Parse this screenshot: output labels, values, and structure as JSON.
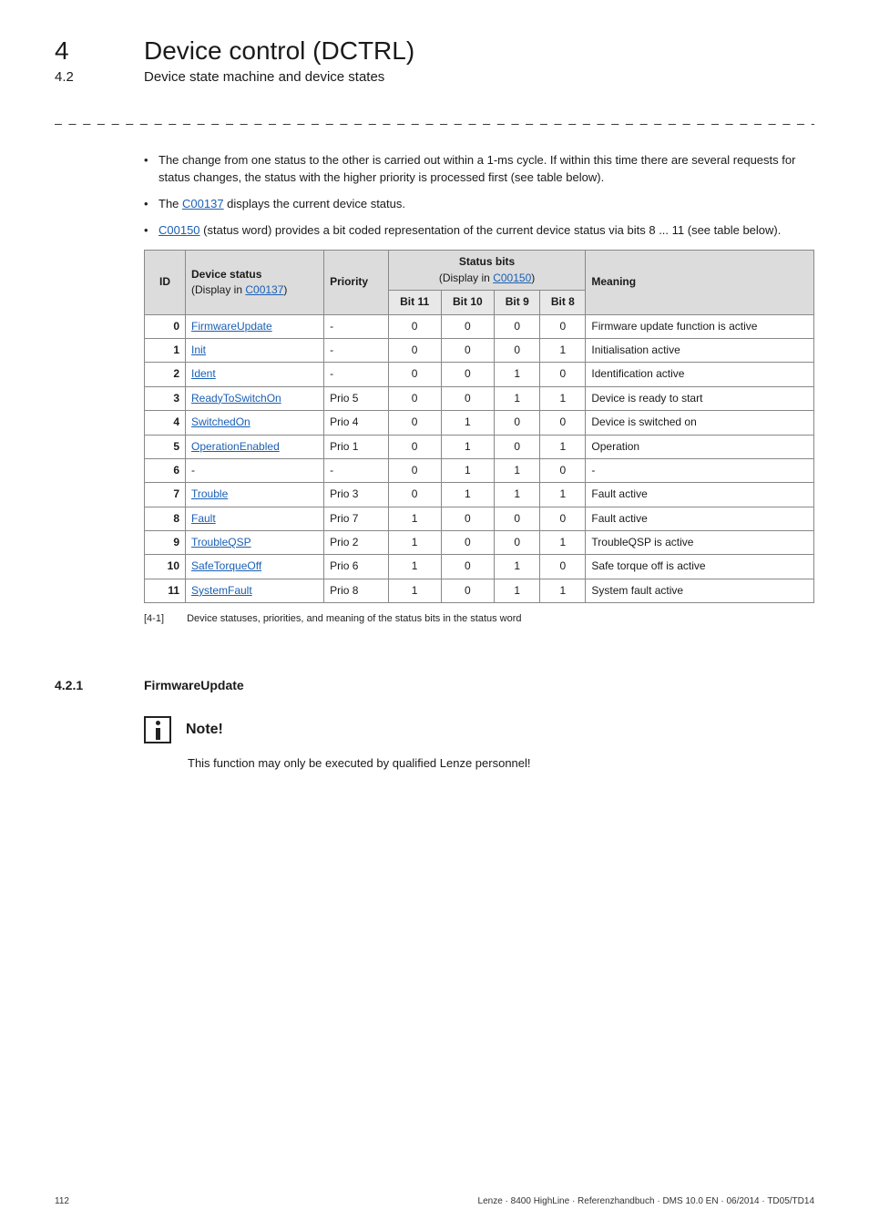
{
  "header": {
    "chapter_num": "4",
    "chapter_title": "Device control (DCTRL)",
    "section_num": "4.2",
    "section_title": "Device state machine and device states",
    "dashes": "_ _ _ _ _ _ _ _ _ _ _ _ _ _ _ _ _ _ _ _ _ _ _ _ _ _ _ _ _ _ _ _ _ _ _ _ _ _ _ _ _ _ _ _ _ _ _ _ _ _ _ _ _ _ _ _ _ _ _ _ _ _ _ _"
  },
  "bullets": {
    "b1_pre": "The change from one status to the other is carried out within a 1-ms cycle. If within this time there are several requests for status changes, the status with the higher priority is processed first (see table below).",
    "b2_pre": "The ",
    "b2_link": "C00137",
    "b2_post": " displays the current device status.",
    "b3_link": "C00150",
    "b3_post": " (status word) provides a bit coded representation of the current device status via bits 8 ... 11 (see table below)."
  },
  "table": {
    "headers": {
      "id": "ID",
      "device_status": "Device status",
      "device_status_sub": "(Display in ",
      "device_status_code": "C00137",
      "device_status_sub_close": ")",
      "priority": "Priority",
      "status_bits": "Status bits",
      "status_bits_sub": "(Display in ",
      "status_bits_code": "C00150",
      "status_bits_sub_close": ")",
      "meaning": "Meaning",
      "bit11": "Bit 11",
      "bit10": "Bit 10",
      "bit9": "Bit 9",
      "bit8": "Bit 8"
    },
    "rows": [
      {
        "id": "0",
        "status": "FirmwareUpdate",
        "priority": "-",
        "b11": "0",
        "b10": "0",
        "b9": "0",
        "b8": "0",
        "meaning": "Firmware update function is active"
      },
      {
        "id": "1",
        "status": "Init",
        "priority": "-",
        "b11": "0",
        "b10": "0",
        "b9": "0",
        "b8": "1",
        "meaning": "Initialisation active"
      },
      {
        "id": "2",
        "status": "Ident",
        "priority": "-",
        "b11": "0",
        "b10": "0",
        "b9": "1",
        "b8": "0",
        "meaning": "Identification active"
      },
      {
        "id": "3",
        "status": "ReadyToSwitchOn",
        "priority": "Prio 5",
        "b11": "0",
        "b10": "0",
        "b9": "1",
        "b8": "1",
        "meaning": "Device is ready to start"
      },
      {
        "id": "4",
        "status": "SwitchedOn",
        "priority": "Prio 4",
        "b11": "0",
        "b10": "1",
        "b9": "0",
        "b8": "0",
        "meaning": "Device is switched on"
      },
      {
        "id": "5",
        "status": "OperationEnabled",
        "priority": "Prio 1",
        "b11": "0",
        "b10": "1",
        "b9": "0",
        "b8": "1",
        "meaning": "Operation"
      },
      {
        "id": "6",
        "status": "-",
        "priority": "-",
        "b11": "0",
        "b10": "1",
        "b9": "1",
        "b8": "0",
        "meaning": "-"
      },
      {
        "id": "7",
        "status": "Trouble",
        "priority": "Prio 3",
        "b11": "0",
        "b10": "1",
        "b9": "1",
        "b8": "1",
        "meaning": "Fault active"
      },
      {
        "id": "8",
        "status": "Fault",
        "priority": "Prio 7",
        "b11": "1",
        "b10": "0",
        "b9": "0",
        "b8": "0",
        "meaning": "Fault active"
      },
      {
        "id": "9",
        "status": "TroubleQSP",
        "priority": "Prio 2",
        "b11": "1",
        "b10": "0",
        "b9": "0",
        "b8": "1",
        "meaning": "TroubleQSP is active"
      },
      {
        "id": "10",
        "status": "SafeTorqueOff",
        "priority": "Prio 6",
        "b11": "1",
        "b10": "0",
        "b9": "1",
        "b8": "0",
        "meaning": "Safe torque off is active"
      },
      {
        "id": "11",
        "status": "SystemFault",
        "priority": "Prio 8",
        "b11": "1",
        "b10": "0",
        "b9": "1",
        "b8": "1",
        "meaning": "System fault active"
      }
    ],
    "caption_tag": "[4-1]",
    "caption_text": "Device statuses, priorities, and meaning of the status bits in the status word"
  },
  "subsection": {
    "num": "4.2.1",
    "title": "FirmwareUpdate"
  },
  "note": {
    "label": "Note!",
    "text": "This function may only be executed by qualified Lenze personnel!"
  },
  "footer": {
    "page": "112",
    "right": "Lenze · 8400 HighLine · Referenzhandbuch · DMS 10.0 EN · 06/2014 · TD05/TD14"
  }
}
